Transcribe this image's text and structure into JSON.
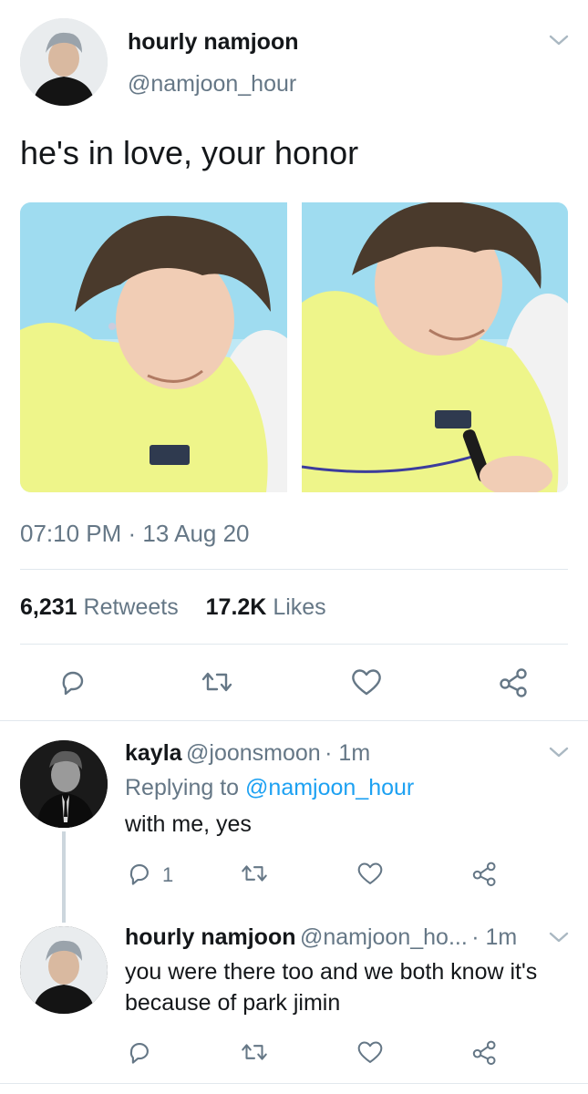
{
  "main_tweet": {
    "display_name": "hourly namjoon",
    "handle": "@namjoon_hour",
    "text": "he's in love, your honor",
    "timestamp": "07:10 PM · 13 Aug 20",
    "retweets_count": "6,231",
    "retweets_label": "Retweets",
    "likes_count": "17.2K",
    "likes_label": "Likes",
    "actions": [
      "reply-icon",
      "retweet-icon",
      "like-icon",
      "share-icon"
    ]
  },
  "replies": [
    {
      "display_name": "kayla",
      "handle": "@joonsmoon",
      "time": "· 1m",
      "replying_prefix": "Replying to",
      "replying_to": "@namjoon_hour",
      "text": "with me, yes",
      "reply_count": "1"
    },
    {
      "display_name": "hourly namjoon",
      "handle": "@namjoon_ho...",
      "time": "· 1m",
      "text_line1": "you were there too and we both know it's",
      "text_line2": "because of park jimin"
    }
  ],
  "colors": {
    "accent": "#1da1f2",
    "text": "#14171a",
    "secondary": "#657786",
    "divider": "#e1e8ed"
  }
}
